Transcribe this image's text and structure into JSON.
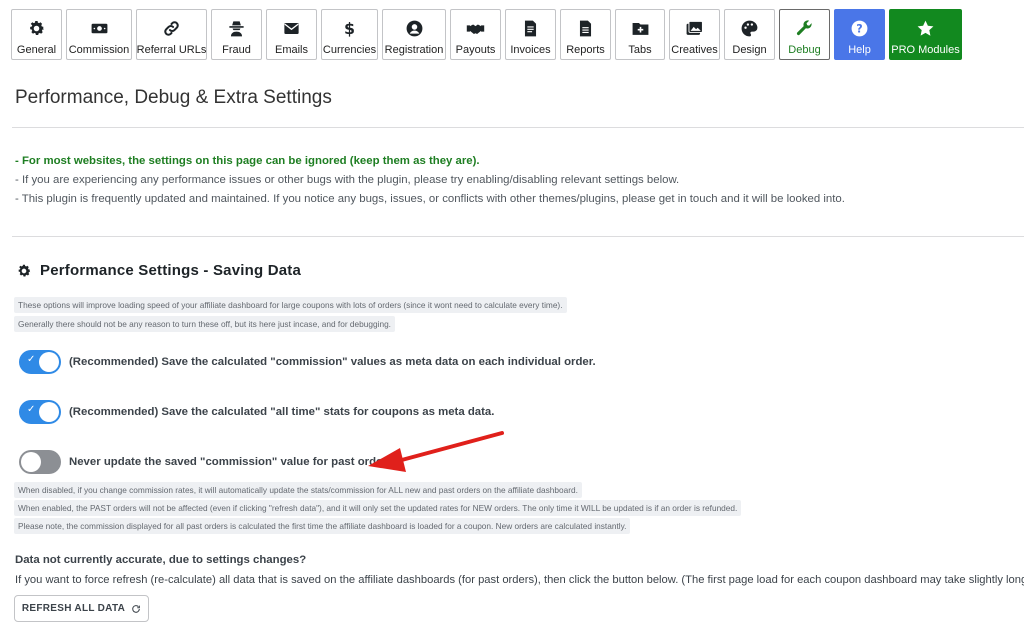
{
  "tabs": [
    {
      "key": "general",
      "label": "General",
      "icon": "gear-icon"
    },
    {
      "key": "commission",
      "label": "Commission",
      "icon": "money-icon"
    },
    {
      "key": "referral-urls",
      "label": "Referral URLs",
      "icon": "link-icon"
    },
    {
      "key": "fraud",
      "label": "Fraud",
      "icon": "spy-icon"
    },
    {
      "key": "emails",
      "label": "Emails",
      "icon": "envelope-icon"
    },
    {
      "key": "currencies",
      "label": "Currencies",
      "icon": "dollar-icon"
    },
    {
      "key": "registration",
      "label": "Registration",
      "icon": "user-icon"
    },
    {
      "key": "payouts",
      "label": "Payouts",
      "icon": "handshake-icon"
    },
    {
      "key": "invoices",
      "label": "Invoices",
      "icon": "invoice-icon"
    },
    {
      "key": "reports",
      "label": "Reports",
      "icon": "file-icon"
    },
    {
      "key": "tabs",
      "label": "Tabs",
      "icon": "folder-plus-icon"
    },
    {
      "key": "creatives",
      "label": "Creatives",
      "icon": "images-icon"
    },
    {
      "key": "design",
      "label": "Design",
      "icon": "palette-icon"
    },
    {
      "key": "debug",
      "label": "Debug",
      "icon": "wrench-icon",
      "active": true
    },
    {
      "key": "help",
      "label": "Help",
      "icon": "question-icon"
    },
    {
      "key": "pro-modules",
      "label": "PRO Modules",
      "icon": "star-icon"
    }
  ],
  "page": {
    "title": "Performance, Debug & Extra Settings",
    "intro": [
      "- For most websites, the settings on this page can be ignored (keep them as they are).",
      "- If you are experiencing any performance issues or other bugs with the plugin, please try enabling/disabling relevant settings below.",
      "- This plugin is frequently updated and maintained. If you notice any bugs, issues, or conflicts with other themes/plugins, please get in touch and it will be looked into."
    ]
  },
  "performance": {
    "title": "Performance Settings - Saving Data",
    "notes": [
      "These options will improve loading speed of your affiliate dashboard for large coupons with lots of orders (since it wont need to calculate every time).",
      "Generally there should not be any reason to turn these off, but its here just incase, and for debugging."
    ],
    "toggles": [
      {
        "label": "(Recommended) Save the calculated \"commission\" values as meta data on each individual order.",
        "enabled": true
      },
      {
        "label": "(Recommended) Save the calculated \"all time\" stats for coupons as meta data.",
        "enabled": true
      },
      {
        "label": "Never update the saved \"commission\" value for past orders.",
        "enabled": false
      }
    ],
    "never_update_notes": [
      "When disabled, if you change commission rates, it will automatically update the stats/commission for ALL new and past orders on the affiliate dashboard.",
      "When enabled, the PAST orders will not be affected (even if clicking \"refresh data\"), and it will only set the updated rates for NEW orders. The only time it WILL be updated is if an order is refunded.",
      "Please note, the commission displayed for all past orders is calculated the first time the affiliate dashboard is loaded for a coupon. New orders are calculated instantly."
    ]
  },
  "refresh": {
    "heading": "Data not currently accurate, due to settings changes?",
    "text": "If you want to force refresh (re-calculate) all data that is saved on the affiliate dashboards (for past orders), then click the button below. (The first page load for each coupon dashboard may take slightly longer.)",
    "button_label": "REFRESH ALL DATA"
  },
  "colors": {
    "accent_green": "#1e7e22",
    "toggle_on": "#2f8ae6",
    "toggle_off": "#8c8f94",
    "help_tab": "#4a76e8",
    "pro_tab": "#12891f",
    "annotation_arrow": "#e0201b"
  }
}
